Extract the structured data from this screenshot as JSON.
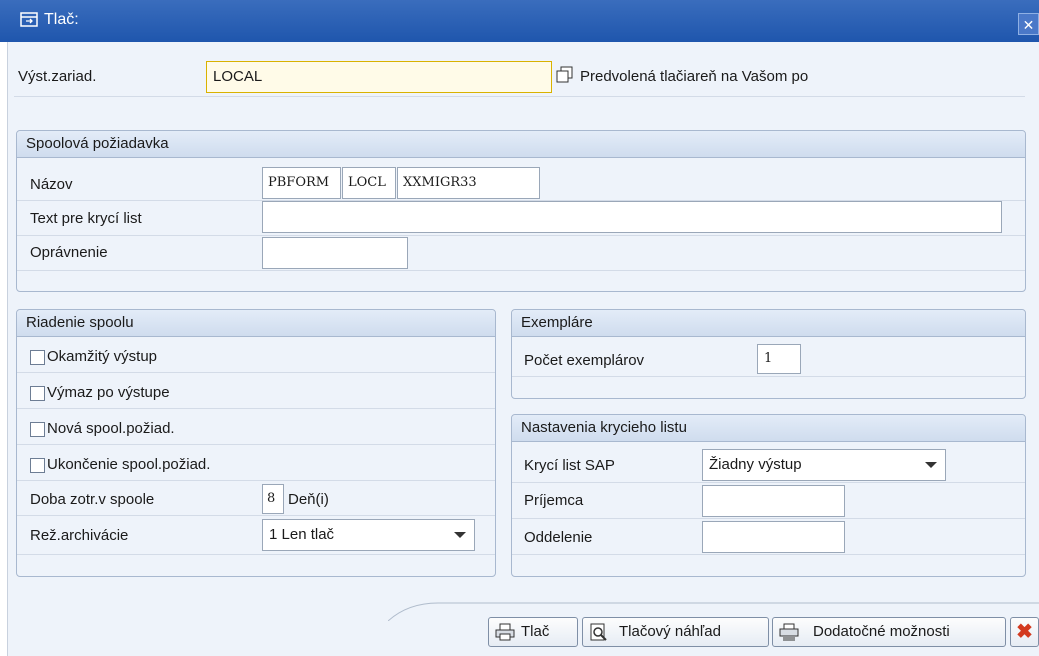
{
  "window": {
    "title": "Tlač:",
    "close_glyph": "✕"
  },
  "device": {
    "label": "Výst.zariad.",
    "value": "LOCAL",
    "description": "Predvolená tlačiareň na Vašom po"
  },
  "spool_request": {
    "title": "Spoolová požiadavka",
    "name_label": "Názov",
    "name_parts": [
      "PBFORM",
      "LOCL",
      "XXMIGR33"
    ],
    "cover_text_label": "Text pre krycí list",
    "cover_text_value": "",
    "authorization_label": "Oprávnenie",
    "authorization_value": ""
  },
  "spool_control": {
    "title": "Riadenie spoolu",
    "options": [
      {
        "label": "Okamžitý výstup",
        "checked": false
      },
      {
        "label": "Výmaz po výstupe",
        "checked": false
      },
      {
        "label": "Nová spool.požiad.",
        "checked": false
      },
      {
        "label": "Ukončenie spool.požiad.",
        "checked": false
      }
    ],
    "retention_label": "Doba zotr.v spoole",
    "retention_value": "8",
    "retention_unit": "Deň(i)",
    "archive_label": "Rež.archivácie",
    "archive_value": "1 Len tlač"
  },
  "copies": {
    "title": "Exempláre",
    "count_label": "Počet exemplárov",
    "count_value": "1"
  },
  "cover_sheet": {
    "title": "Nastavenia krycieho listu",
    "sap_cover_label": "Krycí list SAP",
    "sap_cover_value": "Žiadny výstup",
    "recipient_label": "Príjemca",
    "recipient_value": "",
    "department_label": "Oddelenie",
    "department_value": ""
  },
  "buttons": {
    "print": "Tlač",
    "preview": "Tlačový náhľad",
    "more_options": "Dodatočné možnosti"
  },
  "colors": {
    "titlebar": "#1f56ad",
    "dialog_bg": "#eef3fa",
    "cancel": "#d33a1f"
  }
}
